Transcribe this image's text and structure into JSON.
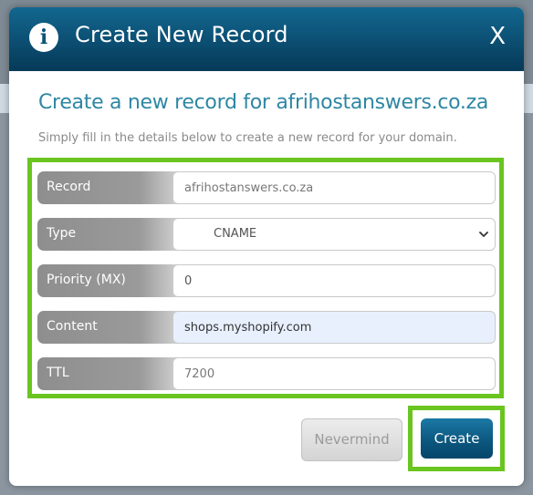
{
  "dialog": {
    "title": "Create New Record",
    "close_label": "X",
    "heading": "Create a new record for afrihostanswers.co.za",
    "subtext": "Simply fill in the details below to create a new record for your domain."
  },
  "fields": [
    {
      "label": "Record",
      "placeholder": "afrihostanswers.co.za",
      "value": ""
    },
    {
      "label": "Type",
      "value": "CNAME"
    },
    {
      "label": "Priority (MX)",
      "value": "0"
    },
    {
      "label": "Content",
      "value": "shops.myshopify.com"
    },
    {
      "label": "TTL",
      "placeholder": "7200",
      "value": ""
    }
  ],
  "buttons": {
    "nevermind": "Nevermind",
    "create": "Create"
  },
  "colors": {
    "header": "#0d5378",
    "highlight_outline": "#6ac520",
    "heading_text": "#2e87a3",
    "autofill_background": "#e8f0fe"
  },
  "icons": {
    "header_icon": "info-icon",
    "select_icon": "chevron-down-icon"
  }
}
